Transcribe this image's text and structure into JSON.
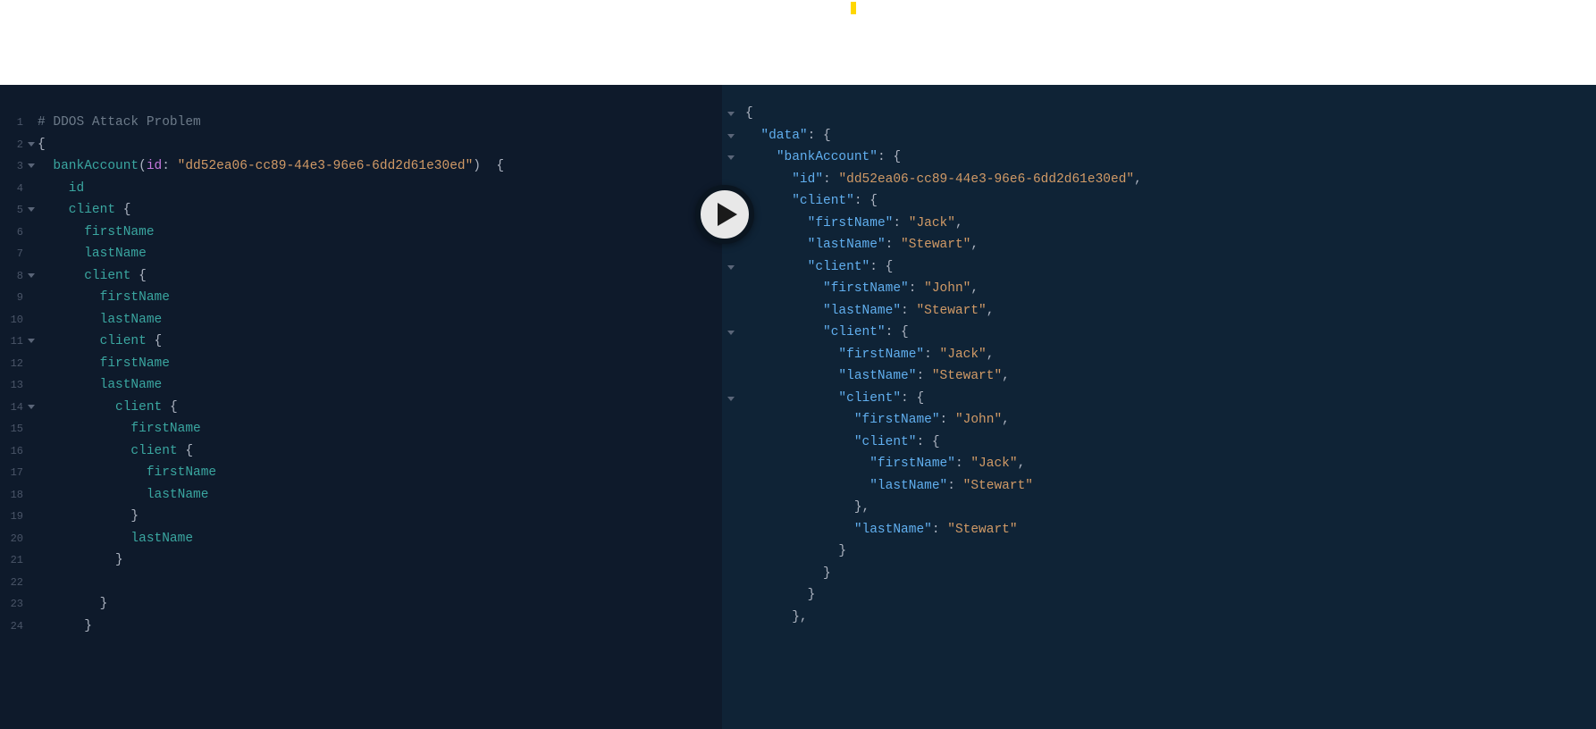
{
  "left": {
    "lines": [
      {
        "n": "1",
        "fold": false,
        "segs": [
          {
            "c": "comment",
            "t": "# DDOS Attack Problem"
          }
        ]
      },
      {
        "n": "2",
        "fold": true,
        "segs": [
          {
            "c": "bracew",
            "t": "{"
          }
        ]
      },
      {
        "n": "3",
        "fold": true,
        "segs": [
          {
            "c": "field",
            "t": "  bankAccount"
          },
          {
            "c": "punct",
            "t": "("
          },
          {
            "c": "arg",
            "t": "id"
          },
          {
            "c": "punct",
            "t": ": "
          },
          {
            "c": "string",
            "t": "\"dd52ea06-cc89-44e3-96e6-6dd2d61e30ed\""
          },
          {
            "c": "punct",
            "t": ")  {"
          }
        ]
      },
      {
        "n": "4",
        "fold": false,
        "segs": [
          {
            "c": "field",
            "t": "    id"
          }
        ]
      },
      {
        "n": "5",
        "fold": true,
        "segs": [
          {
            "c": "field",
            "t": "    client "
          },
          {
            "c": "punct",
            "t": "{"
          }
        ]
      },
      {
        "n": "6",
        "fold": false,
        "segs": [
          {
            "c": "field",
            "t": "      firstName"
          }
        ]
      },
      {
        "n": "7",
        "fold": false,
        "segs": [
          {
            "c": "field",
            "t": "      lastName"
          }
        ]
      },
      {
        "n": "8",
        "fold": true,
        "segs": [
          {
            "c": "field",
            "t": "      client "
          },
          {
            "c": "punct",
            "t": "{"
          }
        ]
      },
      {
        "n": "9",
        "fold": false,
        "segs": [
          {
            "c": "field",
            "t": "        firstName"
          }
        ]
      },
      {
        "n": "10",
        "fold": false,
        "segs": [
          {
            "c": "field",
            "t": "        lastName"
          }
        ]
      },
      {
        "n": "11",
        "fold": true,
        "segs": [
          {
            "c": "field",
            "t": "        client "
          },
          {
            "c": "punct",
            "t": "{"
          }
        ]
      },
      {
        "n": "12",
        "fold": false,
        "segs": [
          {
            "c": "field",
            "t": "        firstName"
          }
        ]
      },
      {
        "n": "13",
        "fold": false,
        "segs": [
          {
            "c": "field",
            "t": "        lastName"
          }
        ]
      },
      {
        "n": "14",
        "fold": true,
        "segs": [
          {
            "c": "field",
            "t": "          client "
          },
          {
            "c": "punct",
            "t": "{"
          }
        ]
      },
      {
        "n": "15",
        "fold": false,
        "segs": [
          {
            "c": "field",
            "t": "            firstName"
          }
        ]
      },
      {
        "n": "16",
        "fold": false,
        "segs": [
          {
            "c": "field",
            "t": "            client "
          },
          {
            "c": "punct",
            "t": "{"
          }
        ]
      },
      {
        "n": "17",
        "fold": false,
        "segs": [
          {
            "c": "field",
            "t": "              firstName"
          }
        ]
      },
      {
        "n": "18",
        "fold": false,
        "segs": [
          {
            "c": "field",
            "t": "              lastName"
          }
        ]
      },
      {
        "n": "19",
        "fold": false,
        "segs": [
          {
            "c": "punct",
            "t": "            }"
          }
        ]
      },
      {
        "n": "20",
        "fold": false,
        "segs": [
          {
            "c": "field",
            "t": "            lastName"
          }
        ]
      },
      {
        "n": "21",
        "fold": false,
        "segs": [
          {
            "c": "punct",
            "t": "          }"
          }
        ]
      },
      {
        "n": "22",
        "fold": false,
        "segs": [
          {
            "c": "punct",
            "t": ""
          }
        ]
      },
      {
        "n": "23",
        "fold": false,
        "segs": [
          {
            "c": "punct",
            "t": "        }"
          }
        ]
      },
      {
        "n": "24",
        "fold": false,
        "segs": [
          {
            "c": "punct",
            "t": "      }"
          }
        ]
      }
    ]
  },
  "right": {
    "lines": [
      {
        "fold": true,
        "segs": [
          {
            "c": "bracew",
            "t": "{"
          }
        ]
      },
      {
        "fold": true,
        "segs": [
          {
            "c": "bracew",
            "t": "  "
          },
          {
            "c": "key",
            "t": "\"data\""
          },
          {
            "c": "punct",
            "t": ": {"
          }
        ]
      },
      {
        "fold": true,
        "segs": [
          {
            "c": "bracew",
            "t": "    "
          },
          {
            "c": "key",
            "t": "\"bankAccount\""
          },
          {
            "c": "punct",
            "t": ": {"
          }
        ]
      },
      {
        "fold": false,
        "segs": [
          {
            "c": "bracew",
            "t": "      "
          },
          {
            "c": "key",
            "t": "\"id\""
          },
          {
            "c": "punct",
            "t": ": "
          },
          {
            "c": "val",
            "t": "\"dd52ea06-cc89-44e3-96e6-6dd2d61e30ed\""
          },
          {
            "c": "punct",
            "t": ","
          }
        ]
      },
      {
        "fold": true,
        "segs": [
          {
            "c": "bracew",
            "t": "      "
          },
          {
            "c": "key",
            "t": "\"client\""
          },
          {
            "c": "punct",
            "t": ": {"
          }
        ]
      },
      {
        "fold": false,
        "segs": [
          {
            "c": "bracew",
            "t": "        "
          },
          {
            "c": "key",
            "t": "\"firstName\""
          },
          {
            "c": "punct",
            "t": ": "
          },
          {
            "c": "val",
            "t": "\"Jack\""
          },
          {
            "c": "punct",
            "t": ","
          }
        ]
      },
      {
        "fold": false,
        "segs": [
          {
            "c": "bracew",
            "t": "        "
          },
          {
            "c": "key",
            "t": "\"lastName\""
          },
          {
            "c": "punct",
            "t": ": "
          },
          {
            "c": "val",
            "t": "\"Stewart\""
          },
          {
            "c": "punct",
            "t": ","
          }
        ]
      },
      {
        "fold": true,
        "segs": [
          {
            "c": "bracew",
            "t": "        "
          },
          {
            "c": "key",
            "t": "\"client\""
          },
          {
            "c": "punct",
            "t": ": {"
          }
        ]
      },
      {
        "fold": false,
        "segs": [
          {
            "c": "bracew",
            "t": "          "
          },
          {
            "c": "key",
            "t": "\"firstName\""
          },
          {
            "c": "punct",
            "t": ": "
          },
          {
            "c": "val",
            "t": "\"John\""
          },
          {
            "c": "punct",
            "t": ","
          }
        ]
      },
      {
        "fold": false,
        "segs": [
          {
            "c": "bracew",
            "t": "          "
          },
          {
            "c": "key",
            "t": "\"lastName\""
          },
          {
            "c": "punct",
            "t": ": "
          },
          {
            "c": "val",
            "t": "\"Stewart\""
          },
          {
            "c": "punct",
            "t": ","
          }
        ]
      },
      {
        "fold": true,
        "segs": [
          {
            "c": "bracew",
            "t": "          "
          },
          {
            "c": "key",
            "t": "\"client\""
          },
          {
            "c": "punct",
            "t": ": {"
          }
        ]
      },
      {
        "fold": false,
        "segs": [
          {
            "c": "bracew",
            "t": "            "
          },
          {
            "c": "key",
            "t": "\"firstName\""
          },
          {
            "c": "punct",
            "t": ": "
          },
          {
            "c": "val",
            "t": "\"Jack\""
          },
          {
            "c": "punct",
            "t": ","
          }
        ]
      },
      {
        "fold": false,
        "segs": [
          {
            "c": "bracew",
            "t": "            "
          },
          {
            "c": "key",
            "t": "\"lastName\""
          },
          {
            "c": "punct",
            "t": ": "
          },
          {
            "c": "val",
            "t": "\"Stewart\""
          },
          {
            "c": "punct",
            "t": ","
          }
        ]
      },
      {
        "fold": true,
        "segs": [
          {
            "c": "bracew",
            "t": "            "
          },
          {
            "c": "key",
            "t": "\"client\""
          },
          {
            "c": "punct",
            "t": ": {"
          }
        ]
      },
      {
        "fold": false,
        "segs": [
          {
            "c": "bracew",
            "t": "              "
          },
          {
            "c": "key",
            "t": "\"firstName\""
          },
          {
            "c": "punct",
            "t": ": "
          },
          {
            "c": "val",
            "t": "\"John\""
          },
          {
            "c": "punct",
            "t": ","
          }
        ]
      },
      {
        "fold": false,
        "segs": [
          {
            "c": "bracew",
            "t": "              "
          },
          {
            "c": "key",
            "t": "\"client\""
          },
          {
            "c": "punct",
            "t": ": {"
          }
        ]
      },
      {
        "fold": false,
        "segs": [
          {
            "c": "bracew",
            "t": "                "
          },
          {
            "c": "key",
            "t": "\"firstName\""
          },
          {
            "c": "punct",
            "t": ": "
          },
          {
            "c": "val",
            "t": "\"Jack\""
          },
          {
            "c": "punct",
            "t": ","
          }
        ]
      },
      {
        "fold": false,
        "segs": [
          {
            "c": "bracew",
            "t": "                "
          },
          {
            "c": "key",
            "t": "\"lastName\""
          },
          {
            "c": "punct",
            "t": ": "
          },
          {
            "c": "val",
            "t": "\"Stewart\""
          }
        ]
      },
      {
        "fold": false,
        "segs": [
          {
            "c": "punct",
            "t": "              },"
          }
        ]
      },
      {
        "fold": false,
        "segs": [
          {
            "c": "bracew",
            "t": "              "
          },
          {
            "c": "key",
            "t": "\"lastName\""
          },
          {
            "c": "punct",
            "t": ": "
          },
          {
            "c": "val",
            "t": "\"Stewart\""
          }
        ]
      },
      {
        "fold": false,
        "segs": [
          {
            "c": "punct",
            "t": "            }"
          }
        ]
      },
      {
        "fold": false,
        "segs": [
          {
            "c": "punct",
            "t": "          }"
          }
        ]
      },
      {
        "fold": false,
        "segs": [
          {
            "c": "punct",
            "t": "        }"
          }
        ]
      },
      {
        "fold": false,
        "segs": [
          {
            "c": "punct",
            "t": "      },"
          }
        ]
      }
    ]
  }
}
